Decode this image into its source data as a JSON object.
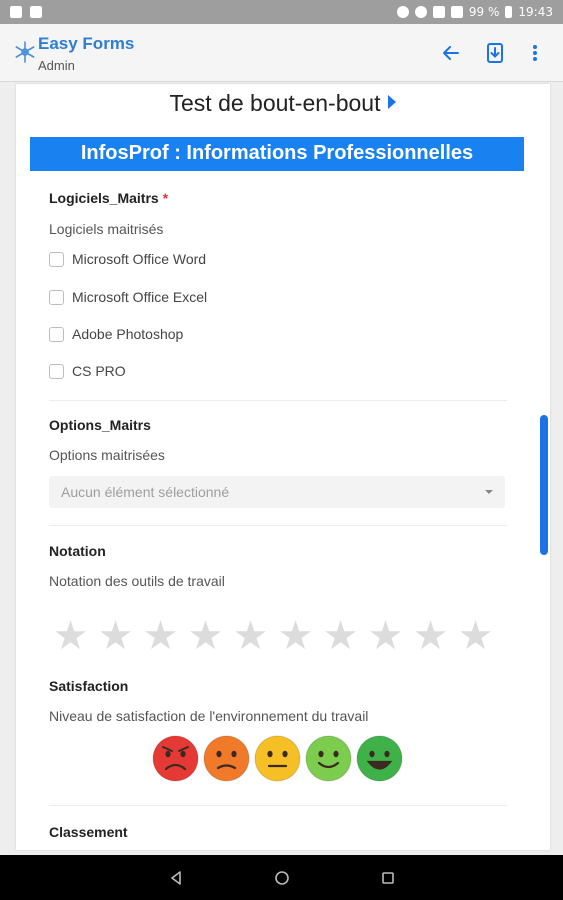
{
  "status_bar": {
    "battery": "99 %",
    "time": "19:43"
  },
  "app_bar": {
    "title": "Easy Forms",
    "subtitle": "Admin",
    "icons": [
      "back-arrow-icon",
      "download-icon",
      "more-vert-icon"
    ]
  },
  "form": {
    "title": "Test de bout-en-bout",
    "section": "InfosProf : Informations Professionnelles",
    "logiciels": {
      "label": "Logiciels_Maitrs",
      "required_mark": "*",
      "description": "Logiciels maitrisés",
      "options": [
        "Microsoft Office Word",
        "Microsoft Office Excel",
        "Adobe Photoshop",
        "CS PRO"
      ]
    },
    "options": {
      "label": "Options_Maitrs",
      "description": "Options maitrisées",
      "placeholder": "Aucun élément sélectionné"
    },
    "notation": {
      "label": "Notation",
      "description": "Notation des outils de travail",
      "stars_total": 10,
      "stars_selected": 0
    },
    "satisfaction": {
      "label": "Satisfaction",
      "description": "Niveau de satisfaction de l'environnement du travail",
      "faces": [
        {
          "name": "very-unhappy-face-icon",
          "color": "#e53935"
        },
        {
          "name": "unhappy-face-icon",
          "color": "#f07a2a"
        },
        {
          "name": "neutral-face-icon",
          "color": "#f6bf26"
        },
        {
          "name": "happy-face-icon",
          "color": "#7ccc4e"
        },
        {
          "name": "very-happy-face-icon",
          "color": "#3fb149"
        }
      ]
    },
    "classement": {
      "label": "Classement"
    }
  },
  "colors": {
    "accent": "#1a73e8",
    "section_header": "#1a82f0",
    "app_title": "#2f7ecf"
  }
}
